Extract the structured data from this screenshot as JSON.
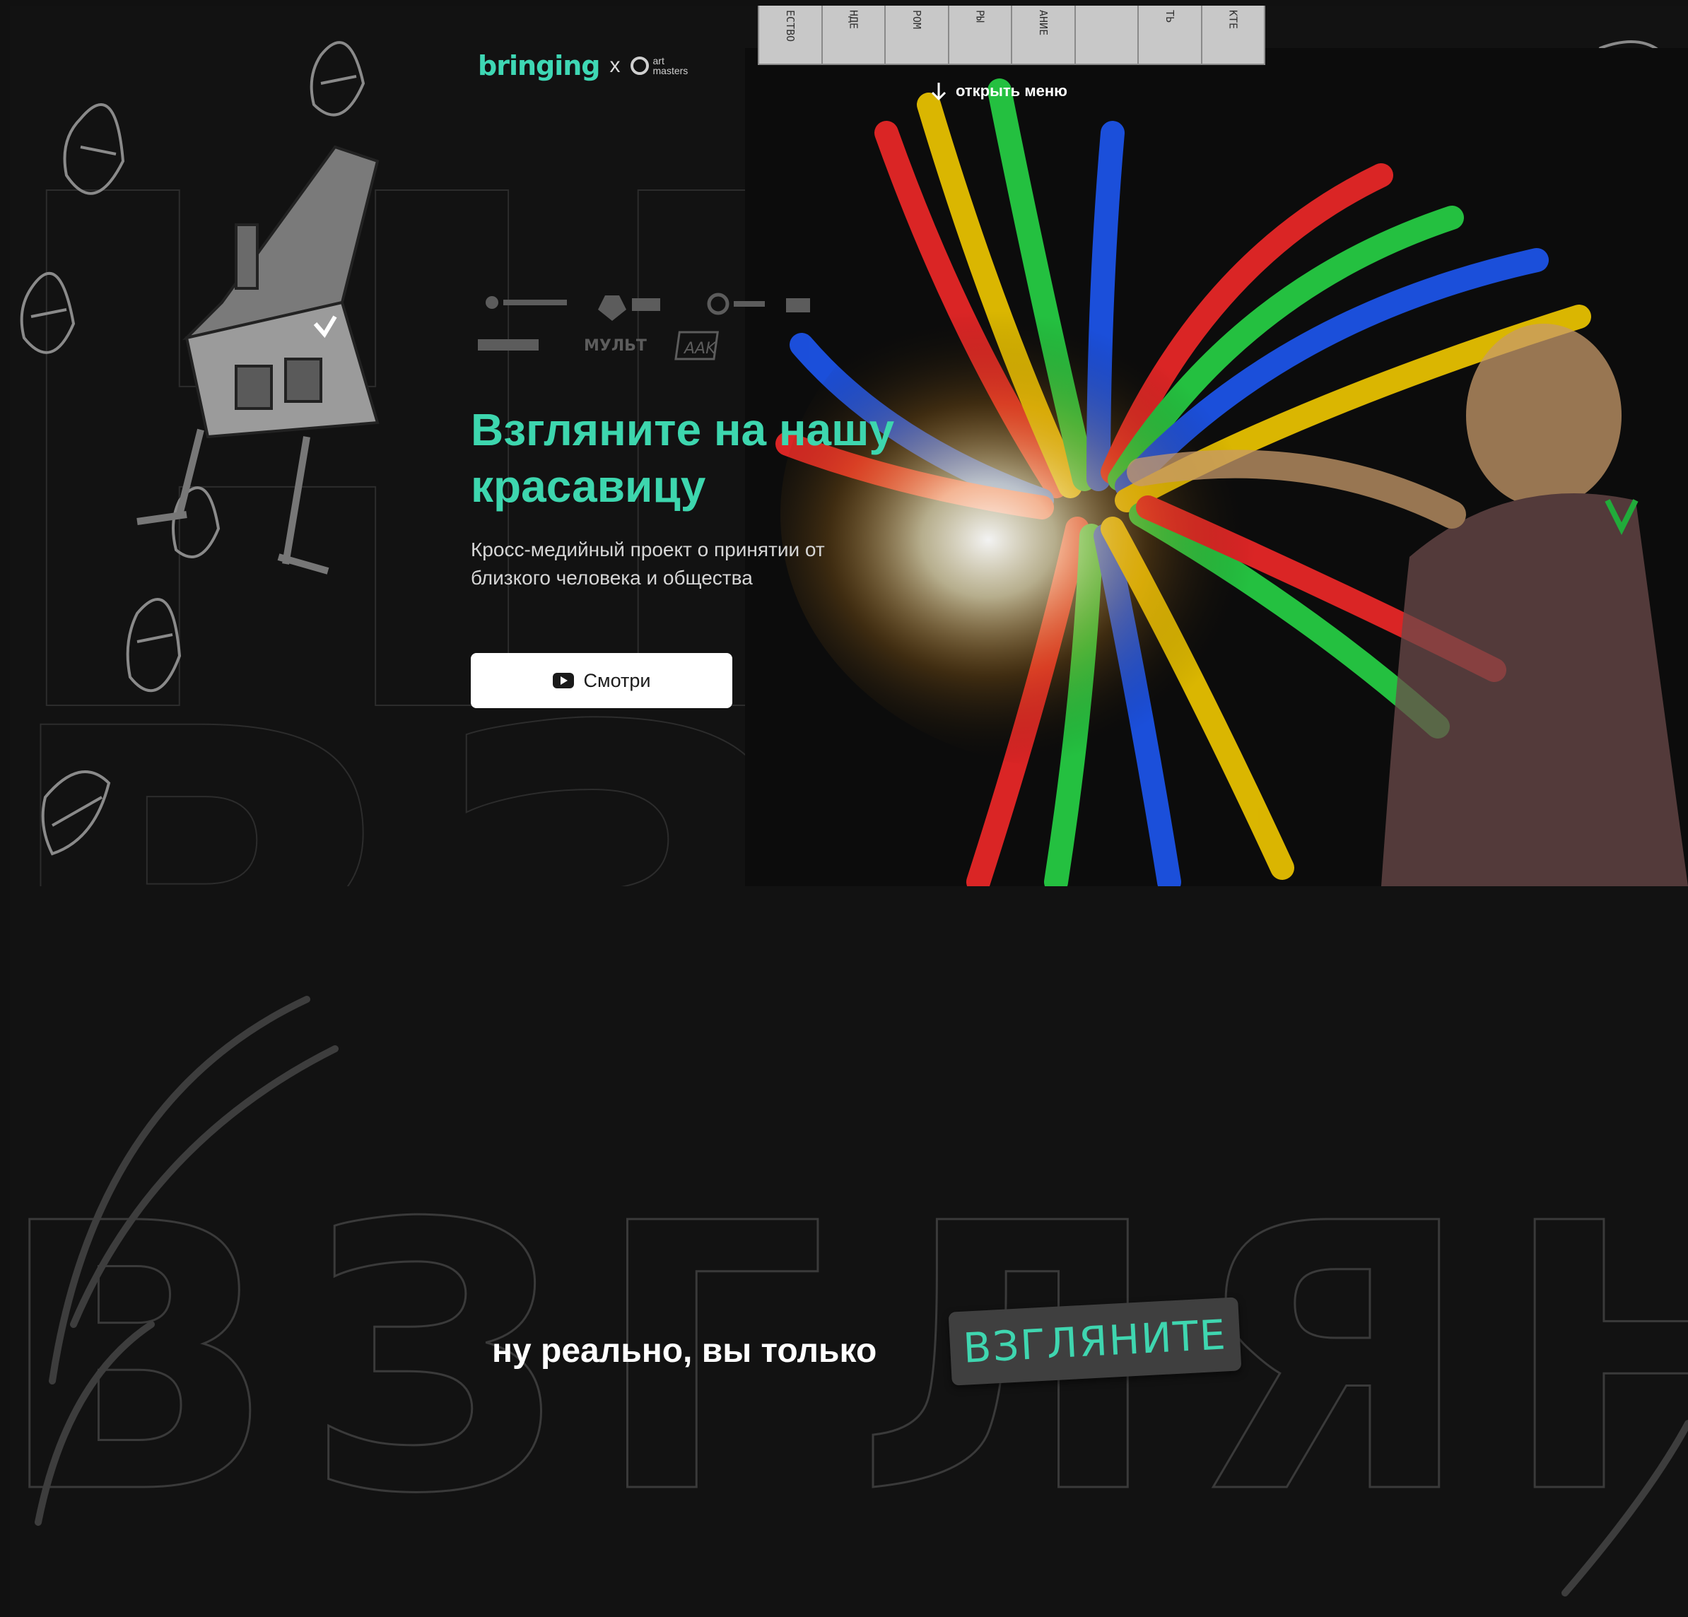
{
  "header": {
    "logo_brand": "bringing",
    "logo_separator": "x",
    "logo_partner_top": "art",
    "logo_partner_bottom": "masters",
    "menu_strip_items": [
      "ЕСТВО",
      "НДЕ",
      "РОМ",
      "РЫ",
      "АНИЕ",
      "",
      "ТЬ",
      "КТЕ"
    ],
    "open_menu_label": "открыть меню"
  },
  "partners": {
    "mult_logo": "МУЛЬТ",
    "aak_logo": "AAK"
  },
  "hero": {
    "title": "Взгляните на нашу красавицу",
    "subtitle": "Кросс-медийный проект о принятии от близкого человека и общества",
    "watch_button": "Смотри",
    "bg_outline_word": "НРЛ",
    "bottom_outline_word": "ВЗГЛЯН"
  },
  "section2": {
    "bg_outline_word": "ВЗГЛЯН",
    "tagline": "ну реально, вы только",
    "badge": "ВЗГЛЯНИТЕ"
  },
  "colors": {
    "background": "#121212",
    "accent": "#3dd6ae",
    "badge_bg": "#3f3f3f",
    "menu_strip": "#c8c8c8"
  },
  "icons": [
    "arrow-down-icon",
    "youtube-icon",
    "eye-doodle-icon",
    "house-illustration-icon"
  ]
}
